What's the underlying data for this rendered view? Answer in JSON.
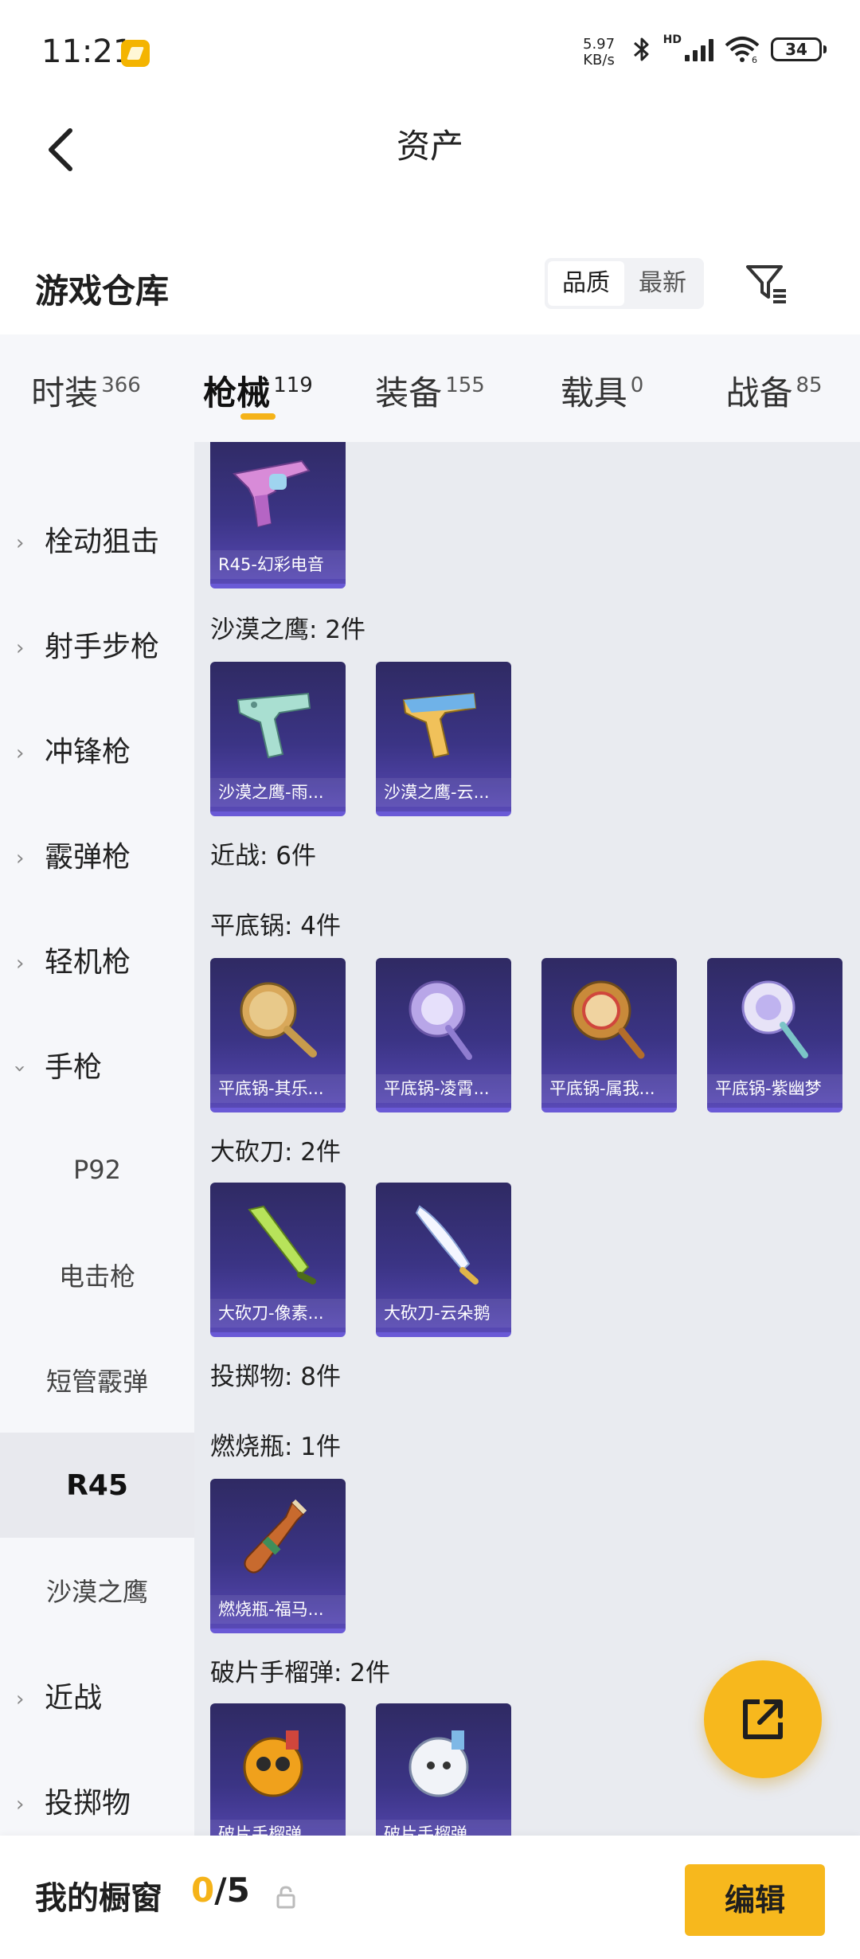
{
  "status_bar": {
    "time": "11:21",
    "net_speed_value": "5.97",
    "net_speed_unit": "KB/s",
    "hd": "HD",
    "wifi_sub": "6",
    "battery": "34"
  },
  "header": {
    "title": "资产"
  },
  "section": {
    "title": "游戏仓库",
    "sort_options": [
      "品质",
      "最新"
    ],
    "active_sort": "品质"
  },
  "tabs": [
    {
      "label": "时装",
      "count": "366"
    },
    {
      "label": "枪械",
      "count": "119",
      "active": true
    },
    {
      "label": "装备",
      "count": "155"
    },
    {
      "label": "载具",
      "count": "0"
    },
    {
      "label": "战备",
      "count": "85"
    }
  ],
  "sidebar": {
    "items": [
      {
        "label": "栓动狙击"
      },
      {
        "label": "射手步枪"
      },
      {
        "label": "冲锋枪"
      },
      {
        "label": "霰弹枪"
      },
      {
        "label": "轻机枪"
      },
      {
        "label": "手枪"
      },
      {
        "label": "P92"
      },
      {
        "label": "电击枪"
      },
      {
        "label": "短管霰弹"
      },
      {
        "label": "R45"
      },
      {
        "label": "沙漠之鹰"
      },
      {
        "label": "近战"
      },
      {
        "label": "投掷物"
      }
    ]
  },
  "content": {
    "groups": [
      {
        "label": "沙漠之鹰: 2件"
      },
      {
        "label": "近战: 6件"
      },
      {
        "label": "平底锅: 4件"
      },
      {
        "label": "大砍刀: 2件"
      },
      {
        "label": "投掷物: 8件"
      },
      {
        "label": "燃烧瓶: 1件"
      },
      {
        "label": "破片手榴弹: 2件"
      }
    ],
    "cards": [
      {
        "name": "R45-幻彩电音"
      },
      {
        "name": "沙漠之鹰-雨..."
      },
      {
        "name": "沙漠之鹰-云..."
      },
      {
        "name": "平底锅-其乐..."
      },
      {
        "name": "平底锅-凌霄..."
      },
      {
        "name": "平底锅-属我..."
      },
      {
        "name": "平底锅-紫幽梦"
      },
      {
        "name": "大砍刀-像素..."
      },
      {
        "name": "大砍刀-云朵鹅"
      },
      {
        "name": "燃烧瓶-福马..."
      },
      {
        "name": "破片手榴弹..."
      },
      {
        "name": "破片手榴弹..."
      }
    ]
  },
  "bottom_bar": {
    "label": "我的橱窗",
    "current": "0",
    "total": "/5",
    "edit_label": "编辑"
  },
  "colors": {
    "accent": "#F7B81D",
    "card_bg": "#3B3485",
    "content_bg": "#E9EBF0",
    "sidebar_bg": "#F6F7FA"
  }
}
